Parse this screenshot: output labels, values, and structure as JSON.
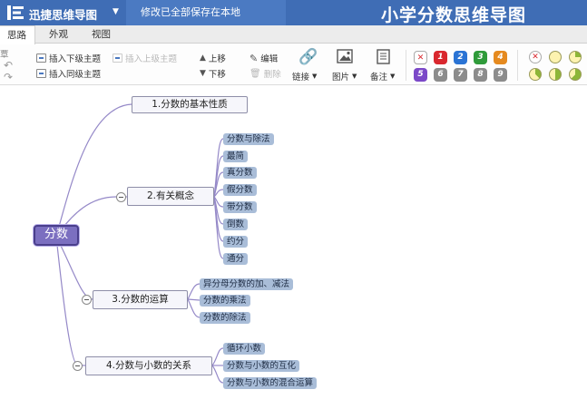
{
  "app": {
    "name": "迅捷思维导图",
    "save_status": "修改已全部保存在本地",
    "document_title": "小学分数思维导图"
  },
  "tabs": [
    {
      "label": "思路"
    },
    {
      "label": "外观"
    },
    {
      "label": "视图"
    }
  ],
  "toolbar": {
    "partial_left": "覃",
    "insert_child": "插入下级主题",
    "insert_parent": "插入上级主题",
    "insert_sibling": "插入同级主题",
    "move_up": "上移",
    "move_down": "下移",
    "edit": "编辑",
    "delete": "删除",
    "link": "链接",
    "image": "图片",
    "note": "备注",
    "priority": [
      "1",
      "2",
      "3",
      "4",
      "5",
      "6",
      "7",
      "8",
      "9"
    ],
    "colors": {
      "priority": [
        "#d9272e",
        "#2a73d4",
        "#2f9b3a",
        "#e58a1f",
        "#7b48c8",
        "#8c8c8c",
        "#8c8c8c",
        "#8c8c8c",
        "#8c8c8c"
      ],
      "accent": "#3f6db5"
    }
  },
  "mindmap": {
    "root": "分数",
    "branches": [
      {
        "label": "1.分数的基本性质",
        "children": []
      },
      {
        "label": "2.有关概念",
        "children": [
          "分数与除法",
          "最简",
          "真分数",
          "假分数",
          "带分数",
          "倒数",
          "约分",
          "通分"
        ]
      },
      {
        "label": "3.分数的运算",
        "children": [
          "异分母分数的加、减法",
          "分数的乘法",
          "分数的除法"
        ]
      },
      {
        "label": "4.分数与小数的关系",
        "children": [
          "循环小数",
          "分数与小数的互化",
          "分数与小数的混合运算"
        ]
      }
    ]
  }
}
